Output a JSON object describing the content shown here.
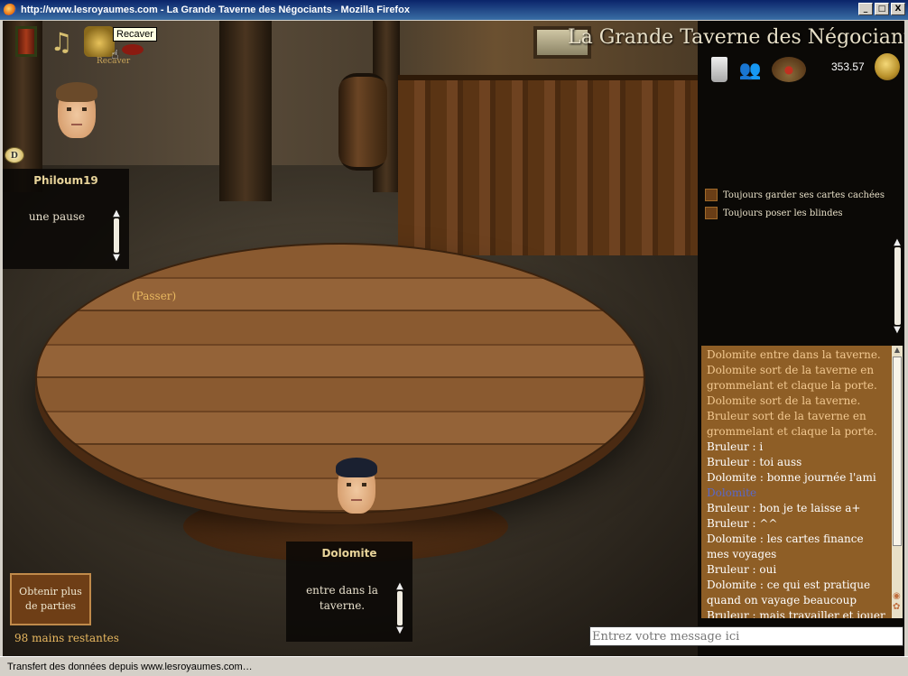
{
  "window": {
    "title": "http://www.lesroyaumes.com - La Grande Taverne des Négociants - Mozilla Firefox",
    "minimize": "_",
    "maximize": "□",
    "close": "X"
  },
  "game": {
    "title": "La Grande Taverne des Négociants",
    "balance": "353.57",
    "tooltip": "Recaver",
    "recaver_sub": "Recaver",
    "passer": "(Passer)",
    "dealer_label": "D"
  },
  "players": [
    {
      "name": "Philoum19",
      "message": "une pause"
    },
    {
      "name": "Dolomite",
      "message": "entre dans la taverne."
    }
  ],
  "options": [
    {
      "label": "Toujours garder ses cartes cachées"
    },
    {
      "label": "Toujours poser les blindes"
    }
  ],
  "chat": [
    {
      "text": "Dolomite entre dans la taverne.",
      "kind": "sys"
    },
    {
      "text": "Dolomite sort de la taverne en grommelant et claque la porte.",
      "kind": "sys"
    },
    {
      "text": "Dolomite sort de la taverne.",
      "kind": "sys"
    },
    {
      "text": "Bruleur sort de la taverne en grommelant et claque la porte.",
      "kind": "sys"
    },
    {
      "text": "Bruleur : i",
      "kind": "msg"
    },
    {
      "text": "Bruleur : toi auss",
      "kind": "msg"
    },
    {
      "text": "Dolomite : bonne journée l'ami",
      "kind": "msg"
    },
    {
      "text": "Dolomite",
      "kind": "name"
    },
    {
      "text": "Bruleur : bon je te laisse a+",
      "kind": "msg"
    },
    {
      "text": "Bruleur : ^^",
      "kind": "msg"
    },
    {
      "text": "Dolomite : les cartes finance mes voyages",
      "kind": "msg"
    },
    {
      "text": "Bruleur : oui",
      "kind": "msg"
    },
    {
      "text": "Dolomite : ce qui est pratique quand on vayage beaucoup",
      "kind": "msg"
    },
    {
      "text": "Bruleur : mais travailler et jouer",
      "kind": "msg"
    }
  ],
  "chat_input_placeholder": "Entrez votre message ici",
  "more_games_button": "Obtenir plus de parties",
  "hands_remaining": "98 mains restantes",
  "status_bar": "Transfert des données depuis www.lesroyaumes.com…",
  "icons": {
    "door": "door-icon",
    "music": "music-notes-icon",
    "coins": "coins-icon",
    "mug": "beer-mug-icon",
    "people": "people-icon",
    "food": "food-plate-icon",
    "balance": "coin-stack-icon"
  },
  "colors": {
    "title_bar": "#0a246a",
    "chat_bg": "#8e5e26",
    "accent_text": "#e8b860"
  }
}
